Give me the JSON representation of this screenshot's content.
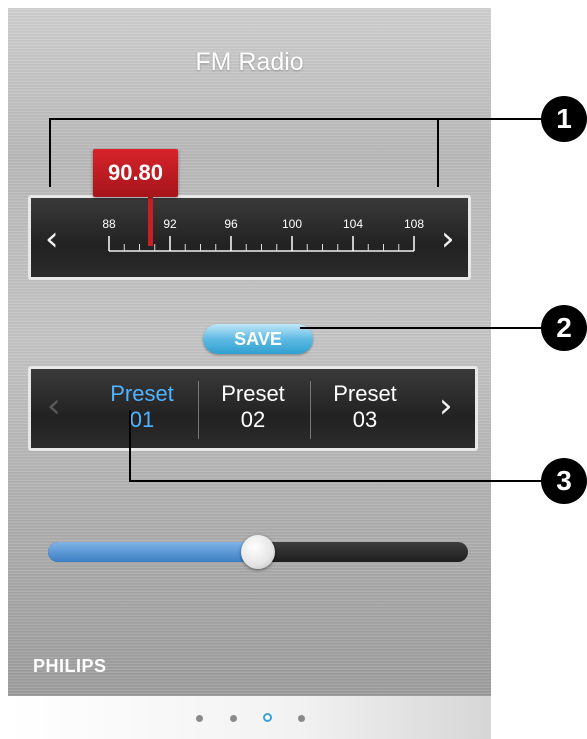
{
  "header": {
    "title": "FM Radio"
  },
  "tuner": {
    "frequency": "90.80",
    "scale_labels": [
      "88",
      "92",
      "96",
      "100",
      "104",
      "108"
    ],
    "prev_arrow": "‹",
    "next_arrow": "›"
  },
  "save_button": {
    "label": "SAVE"
  },
  "presets": {
    "items": [
      {
        "line1": "Preset",
        "line2": "01",
        "active": true
      },
      {
        "line1": "Preset",
        "line2": "02",
        "active": false
      },
      {
        "line1": "Preset",
        "line2": "03",
        "active": false
      }
    ],
    "prev_arrow": "‹",
    "next_arrow": "›"
  },
  "volume": {
    "level_fraction": 0.5
  },
  "brand": {
    "name": "PHILIPS"
  },
  "pager": {
    "count": 4,
    "active_index": 2
  },
  "callouts": [
    "1",
    "2",
    "3"
  ],
  "colors": {
    "frequency_flag": "#c81f25",
    "accent_blue": "#3aa0df",
    "active_preset": "#4fb3ff"
  }
}
